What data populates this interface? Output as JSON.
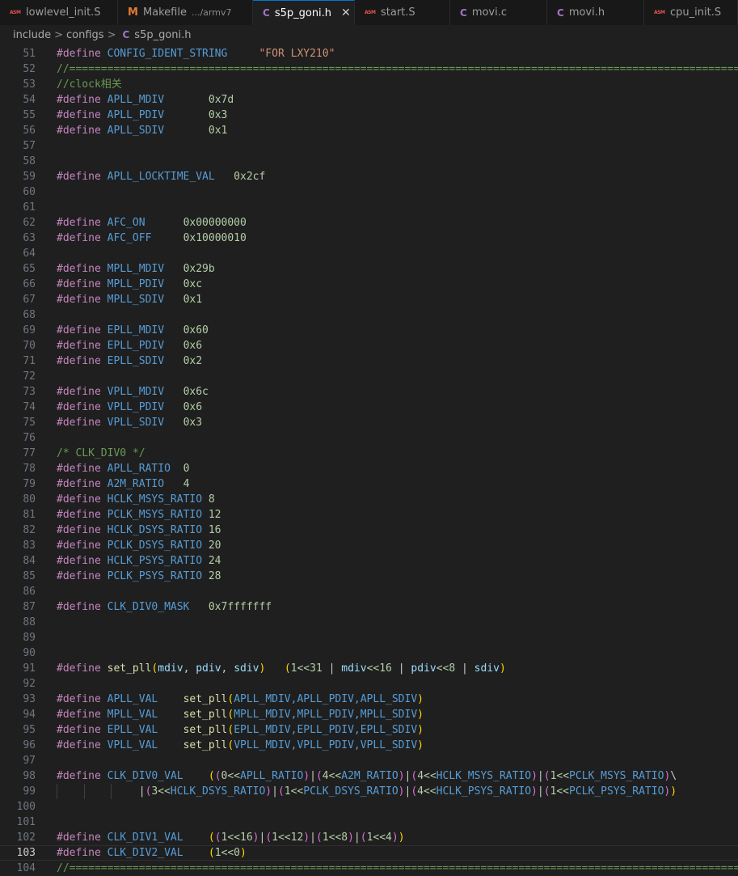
{
  "tabs": [
    {
      "label": "lowlevel_init.S",
      "icon": "ASM",
      "type": "asm",
      "desc": "",
      "active": false
    },
    {
      "label": "Makefile",
      "icon": "M",
      "type": "m",
      "desc": ".../armv7",
      "active": false
    },
    {
      "label": "s5p_goni.h",
      "icon": "C",
      "type": "c",
      "desc": "",
      "active": true,
      "close": "✕"
    },
    {
      "label": "start.S",
      "icon": "ASM",
      "type": "asm",
      "desc": "",
      "active": false
    },
    {
      "label": "movi.c",
      "icon": "C",
      "type": "c",
      "desc": "",
      "active": false
    },
    {
      "label": "movi.h",
      "icon": "C",
      "type": "c",
      "desc": "",
      "active": false
    },
    {
      "label": "cpu_init.S",
      "icon": "ASM",
      "type": "asm",
      "desc": "",
      "active": false
    }
  ],
  "breadcrumb": {
    "items": [
      "include",
      "configs"
    ],
    "file_icon": "C",
    "file": "s5p_goni.h",
    "separator": ">"
  },
  "editor": {
    "current_line": 103,
    "lines": [
      {
        "n": 51,
        "t": [
          [
            "#define ",
            "k"
          ],
          [
            "CONFIG_IDENT_STRING",
            "m"
          ],
          [
            "     ",
            ""
          ],
          [
            "\"FOR LXY210\"",
            "s"
          ]
        ]
      },
      {
        "n": 52,
        "t": [
          [
            "//===========================================================================================================================",
            "cm"
          ]
        ]
      },
      {
        "n": 53,
        "t": [
          [
            "//clock相关",
            "cm"
          ]
        ]
      },
      {
        "n": 54,
        "t": [
          [
            "#define ",
            "k"
          ],
          [
            "APLL_MDIV",
            "m"
          ],
          [
            "       ",
            ""
          ],
          [
            "0x7d",
            "n"
          ]
        ]
      },
      {
        "n": 55,
        "t": [
          [
            "#define ",
            "k"
          ],
          [
            "APLL_PDIV",
            "m"
          ],
          [
            "       ",
            ""
          ],
          [
            "0x3",
            "n"
          ]
        ]
      },
      {
        "n": 56,
        "t": [
          [
            "#define ",
            "k"
          ],
          [
            "APLL_SDIV",
            "m"
          ],
          [
            "       ",
            ""
          ],
          [
            "0x1",
            "n"
          ]
        ]
      },
      {
        "n": 57,
        "t": []
      },
      {
        "n": 58,
        "t": []
      },
      {
        "n": 59,
        "t": [
          [
            "#define ",
            "k"
          ],
          [
            "APLL_LOCKTIME_VAL",
            "m"
          ],
          [
            "   ",
            ""
          ],
          [
            "0x2cf",
            "n"
          ]
        ]
      },
      {
        "n": 60,
        "t": []
      },
      {
        "n": 61,
        "t": []
      },
      {
        "n": 62,
        "t": [
          [
            "#define ",
            "k"
          ],
          [
            "AFC_ON",
            "m"
          ],
          [
            "      ",
            ""
          ],
          [
            "0x00000000",
            "n"
          ]
        ]
      },
      {
        "n": 63,
        "t": [
          [
            "#define ",
            "k"
          ],
          [
            "AFC_OFF",
            "m"
          ],
          [
            "     ",
            ""
          ],
          [
            "0x10000010",
            "n"
          ]
        ]
      },
      {
        "n": 64,
        "t": []
      },
      {
        "n": 65,
        "t": [
          [
            "#define ",
            "k"
          ],
          [
            "MPLL_MDIV",
            "m"
          ],
          [
            "   ",
            ""
          ],
          [
            "0x29b",
            "n"
          ]
        ]
      },
      {
        "n": 66,
        "t": [
          [
            "#define ",
            "k"
          ],
          [
            "MPLL_PDIV",
            "m"
          ],
          [
            "   ",
            ""
          ],
          [
            "0xc",
            "n"
          ]
        ]
      },
      {
        "n": 67,
        "t": [
          [
            "#define ",
            "k"
          ],
          [
            "MPLL_SDIV",
            "m"
          ],
          [
            "   ",
            ""
          ],
          [
            "0x1",
            "n"
          ]
        ]
      },
      {
        "n": 68,
        "t": []
      },
      {
        "n": 69,
        "t": [
          [
            "#define ",
            "k"
          ],
          [
            "EPLL_MDIV",
            "m"
          ],
          [
            "   ",
            ""
          ],
          [
            "0x60",
            "n"
          ]
        ]
      },
      {
        "n": 70,
        "t": [
          [
            "#define ",
            "k"
          ],
          [
            "EPLL_PDIV",
            "m"
          ],
          [
            "   ",
            ""
          ],
          [
            "0x6",
            "n"
          ]
        ]
      },
      {
        "n": 71,
        "t": [
          [
            "#define ",
            "k"
          ],
          [
            "EPLL_SDIV",
            "m"
          ],
          [
            "   ",
            ""
          ],
          [
            "0x2",
            "n"
          ]
        ]
      },
      {
        "n": 72,
        "t": []
      },
      {
        "n": 73,
        "t": [
          [
            "#define ",
            "k"
          ],
          [
            "VPLL_MDIV",
            "m"
          ],
          [
            "   ",
            ""
          ],
          [
            "0x6c",
            "n"
          ]
        ]
      },
      {
        "n": 74,
        "t": [
          [
            "#define ",
            "k"
          ],
          [
            "VPLL_PDIV",
            "m"
          ],
          [
            "   ",
            ""
          ],
          [
            "0x6",
            "n"
          ]
        ]
      },
      {
        "n": 75,
        "t": [
          [
            "#define ",
            "k"
          ],
          [
            "VPLL_SDIV",
            "m"
          ],
          [
            "   ",
            ""
          ],
          [
            "0x3",
            "n"
          ]
        ]
      },
      {
        "n": 76,
        "t": []
      },
      {
        "n": 77,
        "t": [
          [
            "/* CLK_DIV0 */",
            "cm"
          ]
        ]
      },
      {
        "n": 78,
        "t": [
          [
            "#define ",
            "k"
          ],
          [
            "APLL_RATIO",
            "m"
          ],
          [
            "  ",
            ""
          ],
          [
            "0",
            "n"
          ]
        ]
      },
      {
        "n": 79,
        "t": [
          [
            "#define ",
            "k"
          ],
          [
            "A2M_RATIO",
            "m"
          ],
          [
            "   ",
            ""
          ],
          [
            "4",
            "n"
          ]
        ]
      },
      {
        "n": 80,
        "t": [
          [
            "#define ",
            "k"
          ],
          [
            "HCLK_MSYS_RATIO",
            "m"
          ],
          [
            " ",
            ""
          ],
          [
            "8",
            "n"
          ]
        ]
      },
      {
        "n": 81,
        "t": [
          [
            "#define ",
            "k"
          ],
          [
            "PCLK_MSYS_RATIO",
            "m"
          ],
          [
            " ",
            ""
          ],
          [
            "12",
            "n"
          ]
        ]
      },
      {
        "n": 82,
        "t": [
          [
            "#define ",
            "k"
          ],
          [
            "HCLK_DSYS_RATIO",
            "m"
          ],
          [
            " ",
            ""
          ],
          [
            "16",
            "n"
          ]
        ]
      },
      {
        "n": 83,
        "t": [
          [
            "#define ",
            "k"
          ],
          [
            "PCLK_DSYS_RATIO",
            "m"
          ],
          [
            " ",
            ""
          ],
          [
            "20",
            "n"
          ]
        ]
      },
      {
        "n": 84,
        "t": [
          [
            "#define ",
            "k"
          ],
          [
            "HCLK_PSYS_RATIO",
            "m"
          ],
          [
            " ",
            ""
          ],
          [
            "24",
            "n"
          ]
        ]
      },
      {
        "n": 85,
        "t": [
          [
            "#define ",
            "k"
          ],
          [
            "PCLK_PSYS_RATIO",
            "m"
          ],
          [
            " ",
            ""
          ],
          [
            "28",
            "n"
          ]
        ]
      },
      {
        "n": 86,
        "t": []
      },
      {
        "n": 87,
        "t": [
          [
            "#define ",
            "k"
          ],
          [
            "CLK_DIV0_MASK",
            "m"
          ],
          [
            "   ",
            ""
          ],
          [
            "0x7fffffff",
            "n"
          ]
        ]
      },
      {
        "n": 88,
        "t": []
      },
      {
        "n": 89,
        "t": []
      },
      {
        "n": 90,
        "t": []
      },
      {
        "n": 91,
        "t": [
          [
            "#define ",
            "k"
          ],
          [
            "set_pll",
            "f"
          ],
          [
            "(",
            "b1"
          ],
          [
            "mdiv",
            "p"
          ],
          [
            ", ",
            ""
          ],
          [
            "pdiv",
            "p"
          ],
          [
            ", ",
            ""
          ],
          [
            "sdiv",
            "p"
          ],
          [
            ")",
            "b1"
          ],
          [
            "   ",
            ""
          ],
          [
            "(",
            "b1"
          ],
          [
            "1<<31",
            "n"
          ],
          [
            " | ",
            ""
          ],
          [
            "mdiv",
            "p"
          ],
          [
            "<<16",
            "n"
          ],
          [
            " | ",
            ""
          ],
          [
            "pdiv",
            "p"
          ],
          [
            "<<8",
            "n"
          ],
          [
            " | ",
            ""
          ],
          [
            "sdiv",
            "p"
          ],
          [
            ")",
            "b1"
          ]
        ]
      },
      {
        "n": 92,
        "t": []
      },
      {
        "n": 93,
        "t": [
          [
            "#define ",
            "k"
          ],
          [
            "APLL_VAL",
            "m"
          ],
          [
            "    ",
            ""
          ],
          [
            "set_pll",
            "f"
          ],
          [
            "(",
            "b1"
          ],
          [
            "APLL_MDIV,APLL_PDIV,APLL_SDIV",
            "m"
          ],
          [
            ")",
            "b1"
          ]
        ]
      },
      {
        "n": 94,
        "t": [
          [
            "#define ",
            "k"
          ],
          [
            "MPLL_VAL",
            "m"
          ],
          [
            "    ",
            ""
          ],
          [
            "set_pll",
            "f"
          ],
          [
            "(",
            "b1"
          ],
          [
            "MPLL_MDIV,MPLL_PDIV,MPLL_SDIV",
            "m"
          ],
          [
            ")",
            "b1"
          ]
        ]
      },
      {
        "n": 95,
        "t": [
          [
            "#define ",
            "k"
          ],
          [
            "EPLL_VAL",
            "m"
          ],
          [
            "    ",
            ""
          ],
          [
            "set_pll",
            "f"
          ],
          [
            "(",
            "b1"
          ],
          [
            "EPLL_MDIV,EPLL_PDIV,EPLL_SDIV",
            "m"
          ],
          [
            ")",
            "b1"
          ]
        ]
      },
      {
        "n": 96,
        "t": [
          [
            "#define ",
            "k"
          ],
          [
            "VPLL_VAL",
            "m"
          ],
          [
            "    ",
            ""
          ],
          [
            "set_pll",
            "f"
          ],
          [
            "(",
            "b1"
          ],
          [
            "VPLL_MDIV,VPLL_PDIV,VPLL_SDIV",
            "m"
          ],
          [
            ")",
            "b1"
          ]
        ]
      },
      {
        "n": 97,
        "t": []
      },
      {
        "n": 98,
        "t": [
          [
            "#define ",
            "k"
          ],
          [
            "CLK_DIV0_VAL",
            "m"
          ],
          [
            "    ",
            ""
          ],
          [
            "(",
            "b1"
          ],
          [
            "(",
            "b2"
          ],
          [
            "0<<",
            "n"
          ],
          [
            "APLL_RATIO",
            "m"
          ],
          [
            ")",
            "b2"
          ],
          [
            "|",
            ""
          ],
          [
            "(",
            "b2"
          ],
          [
            "4<<",
            "n"
          ],
          [
            "A2M_RATIO",
            "m"
          ],
          [
            ")",
            "b2"
          ],
          [
            "|",
            ""
          ],
          [
            "(",
            "b2"
          ],
          [
            "4<<",
            "n"
          ],
          [
            "HCLK_MSYS_RATIO",
            "m"
          ],
          [
            ")",
            "b2"
          ],
          [
            "|",
            ""
          ],
          [
            "(",
            "b2"
          ],
          [
            "1<<",
            "n"
          ],
          [
            "PCLK_MSYS_RATIO",
            "m"
          ],
          [
            ")",
            "b2"
          ],
          [
            "\\",
            ""
          ]
        ]
      },
      {
        "n": 99,
        "t": [
          [
            "             ",
            ""
          ],
          [
            "|",
            ""
          ],
          [
            "(",
            "b2"
          ],
          [
            "3<<",
            "n"
          ],
          [
            "HCLK_DSYS_RATIO",
            "m"
          ],
          [
            ")",
            "b2"
          ],
          [
            "|",
            ""
          ],
          [
            "(",
            "b2"
          ],
          [
            "1<<",
            "n"
          ],
          [
            "PCLK_DSYS_RATIO",
            "m"
          ],
          [
            ")",
            "b2"
          ],
          [
            "|",
            ""
          ],
          [
            "(",
            "b2"
          ],
          [
            "4<<",
            "n"
          ],
          [
            "HCLK_PSYS_RATIO",
            "m"
          ],
          [
            ")",
            "b2"
          ],
          [
            "|",
            ""
          ],
          [
            "(",
            "b2"
          ],
          [
            "1<<",
            "n"
          ],
          [
            "PCLK_PSYS_RATIO",
            "m"
          ],
          [
            ")",
            "b2"
          ],
          [
            ")",
            "b1"
          ]
        ]
      },
      {
        "n": 100,
        "t": []
      },
      {
        "n": 101,
        "t": []
      },
      {
        "n": 102,
        "t": [
          [
            "#define ",
            "k"
          ],
          [
            "CLK_DIV1_VAL",
            "m"
          ],
          [
            "    ",
            ""
          ],
          [
            "(",
            "b1"
          ],
          [
            "(",
            "b2"
          ],
          [
            "1<<16",
            "n"
          ],
          [
            ")",
            "b2"
          ],
          [
            "|",
            ""
          ],
          [
            "(",
            "b2"
          ],
          [
            "1<<12",
            "n"
          ],
          [
            ")",
            "b2"
          ],
          [
            "|",
            ""
          ],
          [
            "(",
            "b2"
          ],
          [
            "1<<8",
            "n"
          ],
          [
            ")",
            "b2"
          ],
          [
            "|",
            ""
          ],
          [
            "(",
            "b2"
          ],
          [
            "1<<4",
            "n"
          ],
          [
            ")",
            "b2"
          ],
          [
            ")",
            "b1"
          ]
        ]
      },
      {
        "n": 103,
        "t": [
          [
            "#define ",
            "k"
          ],
          [
            "CLK_DIV2_VAL",
            "m"
          ],
          [
            "    ",
            ""
          ],
          [
            "(",
            "b1"
          ],
          [
            "1<<0",
            "n"
          ],
          [
            ")",
            "b1"
          ]
        ]
      },
      {
        "n": 104,
        "t": [
          [
            "//===========================================================================================================================",
            "cm"
          ]
        ]
      }
    ]
  }
}
